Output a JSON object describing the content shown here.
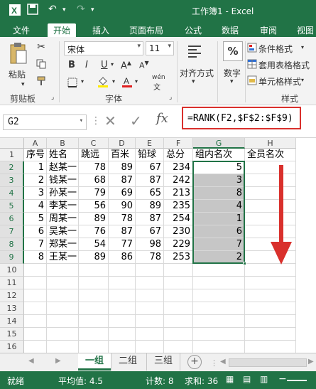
{
  "window": {
    "title": "工作簿1 - Excel"
  },
  "tabs": [
    "文件",
    "开始",
    "插入",
    "页面布局",
    "公式",
    "数据",
    "审阅",
    "视图"
  ],
  "active_tab_index": 1,
  "ribbon": {
    "clipboard": {
      "paste_label": "粘贴",
      "group_label": "剪贴板"
    },
    "font": {
      "font_name": "宋体",
      "font_size": "11",
      "bold": "B",
      "italic": "I",
      "underline": "U",
      "wen": "wén",
      "group_label": "字体"
    },
    "alignment": {
      "label": "对齐方式"
    },
    "number": {
      "label": "数字",
      "symbol": "%"
    },
    "styles": {
      "conditional": "条件格式",
      "table": "套用表格格式",
      "cell": "单元格样式",
      "group_label": "样式"
    }
  },
  "formula_bar": {
    "name_box": "G2",
    "fx": "fx",
    "formula": "=RANK(F2,$F$2:$F$9)"
  },
  "columns": [
    "A",
    "B",
    "C",
    "D",
    "E",
    "F",
    "G",
    "H"
  ],
  "selected_column": "G",
  "headers": [
    "序号",
    "姓名",
    "跳远",
    "百米",
    "铅球",
    "总分",
    "组内名次",
    "全员名次"
  ],
  "rows": [
    {
      "a": "1",
      "b": "赵某一",
      "c": "78",
      "d": "89",
      "e": "67",
      "f": "234",
      "g": "5"
    },
    {
      "a": "2",
      "b": "钱某一",
      "c": "68",
      "d": "87",
      "e": "87",
      "f": "242",
      "g": "3"
    },
    {
      "a": "3",
      "b": "孙某一",
      "c": "79",
      "d": "69",
      "e": "65",
      "f": "213",
      "g": "8"
    },
    {
      "a": "4",
      "b": "李某一",
      "c": "56",
      "d": "90",
      "e": "89",
      "f": "235",
      "g": "4"
    },
    {
      "a": "5",
      "b": "周某一",
      "c": "89",
      "d": "78",
      "e": "87",
      "f": "254",
      "g": "1"
    },
    {
      "a": "6",
      "b": "吴某一",
      "c": "76",
      "d": "87",
      "e": "67",
      "f": "230",
      "g": "6"
    },
    {
      "a": "7",
      "b": "郑某一",
      "c": "54",
      "d": "77",
      "e": "98",
      "f": "229",
      "g": "7"
    },
    {
      "a": "8",
      "b": "王某一",
      "c": "89",
      "d": "86",
      "e": "78",
      "f": "253",
      "g": "2"
    }
  ],
  "row_numbers": [
    "1",
    "2",
    "3",
    "4",
    "5",
    "6",
    "7",
    "8",
    "9",
    "10",
    "11",
    "12",
    "13",
    "14",
    "15",
    "16"
  ],
  "sheets": [
    "一组",
    "二组",
    "三组"
  ],
  "active_sheet_index": 0,
  "status": {
    "mode": "就绪",
    "average": "平均值: 4.5",
    "count": "计数: 8",
    "sum": "求和: 36"
  },
  "colors": {
    "excel_green": "#217346",
    "highlight_red": "#d9302c",
    "selection_gray": "#c6c6c6"
  }
}
